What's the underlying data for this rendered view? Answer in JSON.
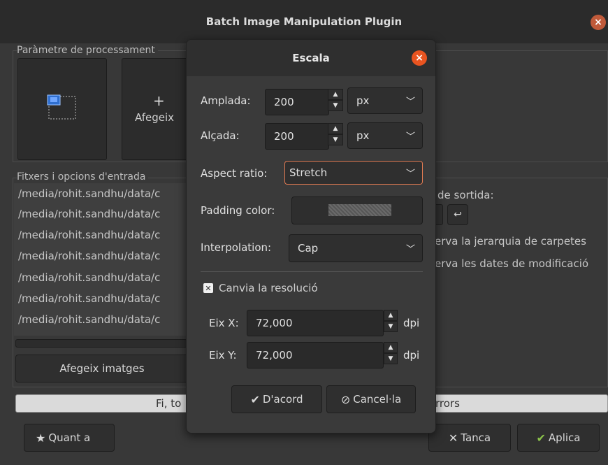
{
  "window": {
    "title": "Batch Image Manipulation Plugin"
  },
  "processing": {
    "label": "Paràmetre de processament",
    "add_label": "Afegeix",
    "add_symbol": "+"
  },
  "files": {
    "label": "Fitxers i opcions d'entrada",
    "items": [
      "/media/rohit.sandhu/data/c",
      "/media/rohit.sandhu/data/c",
      "/media/rohit.sandhu/data/c",
      "/media/rohit.sandhu/data/c",
      "/media/rohit.sandhu/data/c",
      "/media/rohit.sandhu/data/c",
      "/media/rohit.sandhu/data/c"
    ],
    "add_images_button": "Afegeix imatges",
    "progress_text_left": "Fi, to",
    "progress_text_right": "rrors"
  },
  "output": {
    "label": "de sortida:",
    "keep_hierarchy": "erva la jerarquia de carpetes",
    "keep_dates": "erva les dates de modificació"
  },
  "bottom": {
    "about_button": "Quant a",
    "close_button": "Tanca",
    "apply_button": "Aplica"
  },
  "dialog": {
    "title": "Escala",
    "width_label": "Amplada:",
    "width_value": "200",
    "width_unit": "px",
    "height_label": "Alçada:",
    "height_value": "200",
    "height_unit": "px",
    "aspect_label": "Aspect ratio:",
    "aspect_value": "Stretch",
    "padding_label": "Padding color:",
    "interp_label": "Interpolation:",
    "interp_value": "Cap",
    "resolution_label": "Canvia la resolució",
    "x_label": "Eix X:",
    "x_value": "72,000",
    "x_unit": "dpi",
    "y_label": "Eix Y:",
    "y_value": "72,000",
    "y_unit": "dpi",
    "ok_button": "D'acord",
    "cancel_button": "Cancel·la"
  },
  "icons": {
    "close": "close-icon",
    "ok": "check-icon",
    "cancel": "cancel-circle-icon",
    "about": "star-icon",
    "tanca": "x-icon",
    "apply": "checkmark-icon",
    "undo": "undo-icon"
  },
  "colors": {
    "accent": "#e95420",
    "apply_check": "#8bc34a"
  }
}
